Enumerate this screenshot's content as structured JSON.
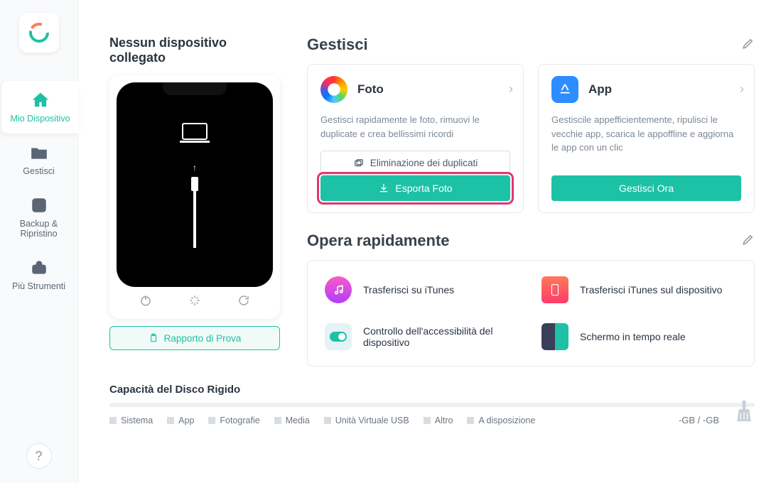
{
  "sidebar": {
    "items": [
      {
        "label": "Mio Dispositivo"
      },
      {
        "label": "Gestisci"
      },
      {
        "label": "Backup & Ripristino"
      },
      {
        "label": "Più Strumenti"
      }
    ]
  },
  "device": {
    "title": "Nessun dispositivo collegato",
    "report_button": "Rapporto di Prova"
  },
  "manage": {
    "title": "Gestisci",
    "photo": {
      "title": "Foto",
      "desc": "Gestisci rapidamente le foto, rimuovi le duplicate e crea bellissimi ricordi",
      "dup_button": "Eliminazione dei duplicati",
      "export_button": "Esporta Foto"
    },
    "app": {
      "title": "App",
      "desc": "Gestiscile appefficientemente, ripulisci le vecchie app, scarica le appoffline e aggiorna le app con un clic",
      "manage_button": "Gestisci Ora"
    }
  },
  "quick": {
    "title": "Opera rapidamente",
    "items": [
      {
        "label": "Trasferisci su iTunes"
      },
      {
        "label": "Trasferisci iTunes sul dispositivo"
      },
      {
        "label": "Controllo dell'accessibilità del dispositivo"
      },
      {
        "label": "Schermo in tempo reale"
      }
    ]
  },
  "storage": {
    "title": "Capacità del Disco Rigido",
    "legend": [
      "Sistema",
      "App",
      "Fotografie",
      "Media",
      "Unità Virtuale USB",
      "Altro",
      "A disposizione"
    ],
    "size": "-GB / -GB"
  }
}
